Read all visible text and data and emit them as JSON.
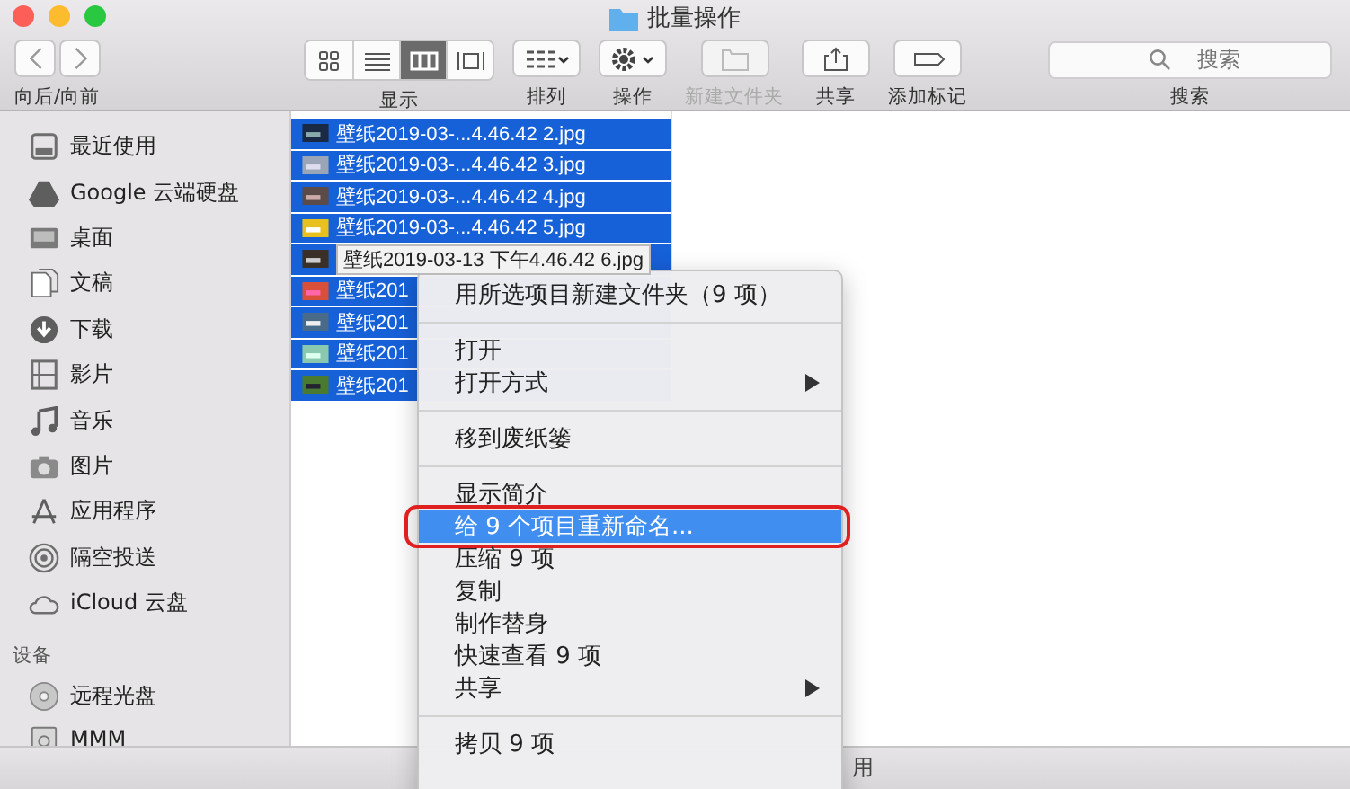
{
  "window": {
    "title": "批量操作"
  },
  "toolbar": {
    "nav": {
      "label": "向后/向前"
    },
    "view": {
      "label": "显示",
      "options": [
        {
          "kind": "icons",
          "selected": false
        },
        {
          "kind": "list",
          "selected": false
        },
        {
          "kind": "columns",
          "selected": true
        },
        {
          "kind": "gallery",
          "selected": false
        }
      ]
    },
    "groups": [
      {
        "kind": "arrange",
        "label": "排列",
        "disabled": false
      },
      {
        "kind": "action",
        "label": "操作",
        "disabled": false
      },
      {
        "kind": "newfolder",
        "label": "新建文件夹",
        "disabled": true
      },
      {
        "kind": "share",
        "label": "共享",
        "disabled": false
      },
      {
        "kind": "tag",
        "label": "添加标记",
        "disabled": false
      }
    ],
    "search": {
      "placeholder": "搜索",
      "label": "搜索"
    }
  },
  "sidebar": {
    "favorites": [
      {
        "label": "最近使用"
      },
      {
        "label": "Google 云端硬盘"
      },
      {
        "label": "桌面"
      },
      {
        "label": "文稿"
      },
      {
        "label": "下载"
      },
      {
        "label": "影片"
      },
      {
        "label": "音乐"
      },
      {
        "label": "图片"
      },
      {
        "label": "应用程序"
      },
      {
        "label": "隔空投送"
      },
      {
        "label": "iCloud 云盘"
      }
    ],
    "devices_heading": "设备",
    "devices": [
      {
        "label": "远程光盘"
      },
      {
        "label": "MMM"
      }
    ]
  },
  "files": [
    {
      "name": "壁纸2019-03-...4.46.42 2.jpg",
      "selected": true,
      "kind": "row"
    },
    {
      "name": "壁纸2019-03-...4.46.42 3.jpg",
      "selected": true,
      "kind": "row"
    },
    {
      "name": "壁纸2019-03-...4.46.42 4.jpg",
      "selected": true,
      "kind": "row"
    },
    {
      "name": "壁纸2019-03-...4.46.42 5.jpg",
      "selected": true,
      "kind": "row"
    },
    {
      "name": "壁纸2019-03-13 下午4.46.42 6.jpg",
      "selected": true,
      "kind": "tooltip"
    },
    {
      "name": "壁纸201",
      "selected": true,
      "kind": "row"
    },
    {
      "name": "壁纸201",
      "selected": true,
      "kind": "row"
    },
    {
      "name": "壁纸201",
      "selected": true,
      "kind": "row"
    },
    {
      "name": "壁纸201",
      "selected": true,
      "kind": "row"
    }
  ],
  "context_menu": [
    {
      "kind": "item",
      "label": "用所选项目新建文件夹（9 项）",
      "submenu": false,
      "selected": false
    },
    {
      "kind": "separator"
    },
    {
      "kind": "item",
      "label": "打开",
      "submenu": false,
      "selected": false
    },
    {
      "kind": "item",
      "label": "打开方式",
      "submenu": true,
      "selected": false
    },
    {
      "kind": "separator"
    },
    {
      "kind": "item",
      "label": "移到废纸篓",
      "submenu": false,
      "selected": false
    },
    {
      "kind": "separator"
    },
    {
      "kind": "item",
      "label": "显示简介",
      "submenu": false,
      "selected": false
    },
    {
      "kind": "item",
      "label": "给 9 个项目重新命名...",
      "submenu": false,
      "selected": true
    },
    {
      "kind": "item",
      "label": "压缩 9 项",
      "submenu": false,
      "selected": false
    },
    {
      "kind": "item",
      "label": "复制",
      "submenu": false,
      "selected": false
    },
    {
      "kind": "item",
      "label": "制作替身",
      "submenu": false,
      "selected": false
    },
    {
      "kind": "item",
      "label": "快速查看 9 项",
      "submenu": false,
      "selected": false
    },
    {
      "kind": "item",
      "label": "共享",
      "submenu": true,
      "selected": false
    },
    {
      "kind": "separator"
    },
    {
      "kind": "item",
      "label": "拷贝 9 项",
      "submenu": false,
      "selected": false
    }
  ],
  "status_bar": {
    "text": "用"
  }
}
